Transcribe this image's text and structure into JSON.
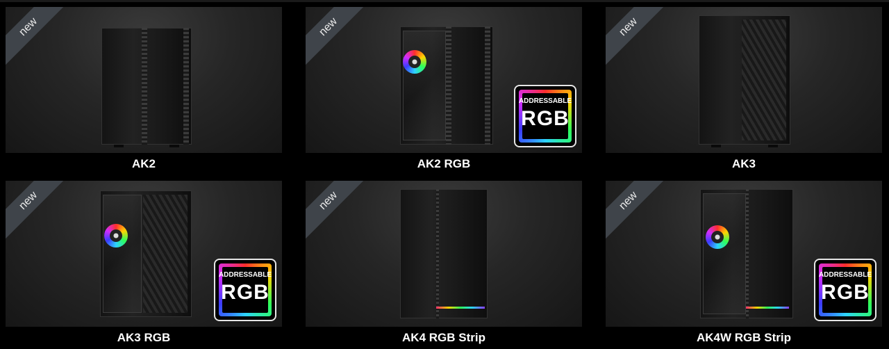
{
  "ribbon_label": "new",
  "badge": {
    "line1": "ADDRESSABLE",
    "line2": "RGB"
  },
  "products": [
    {
      "name": "AK2",
      "new": true,
      "rgb_badge": false
    },
    {
      "name": "AK2 RGB",
      "new": true,
      "rgb_badge": true
    },
    {
      "name": "AK3",
      "new": true,
      "rgb_badge": false
    },
    {
      "name": "AK3 RGB",
      "new": true,
      "rgb_badge": true
    },
    {
      "name": "AK4 RGB Strip",
      "new": true,
      "rgb_badge": false
    },
    {
      "name": "AK4W RGB Strip",
      "new": true,
      "rgb_badge": true
    }
  ]
}
